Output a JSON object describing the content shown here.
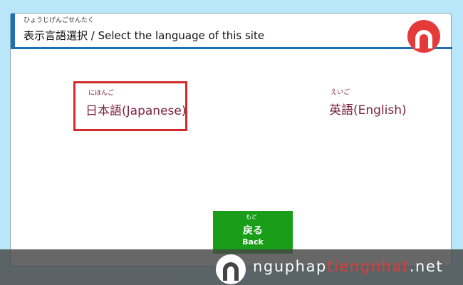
{
  "header": {
    "title_ruby": "ひょうじげんごせんたく",
    "title": "表示言語選択 / Select the language of this site"
  },
  "languages": [
    {
      "ruby": "にほんご",
      "label": "日本語(Japanese)",
      "selected": true
    },
    {
      "ruby": "えいご",
      "label": "英語(English)",
      "selected": false
    }
  ],
  "back_button": {
    "ruby": "もど",
    "label_jp": "戻る",
    "label_en": "Back"
  },
  "watermark": {
    "part1": "nguphap",
    "part2": "tiengnhat",
    "part3": ".net"
  },
  "colors": {
    "accent_blue": "#1e6fb8",
    "selection_red": "#d02a2a",
    "language_text": "#7a1f3c",
    "back_green": "#1a9e1a",
    "logo_red": "#e53a3a"
  },
  "icons": {
    "site_logo": "site-logo-icon",
    "watermark_logo": "watermark-logo-icon"
  }
}
